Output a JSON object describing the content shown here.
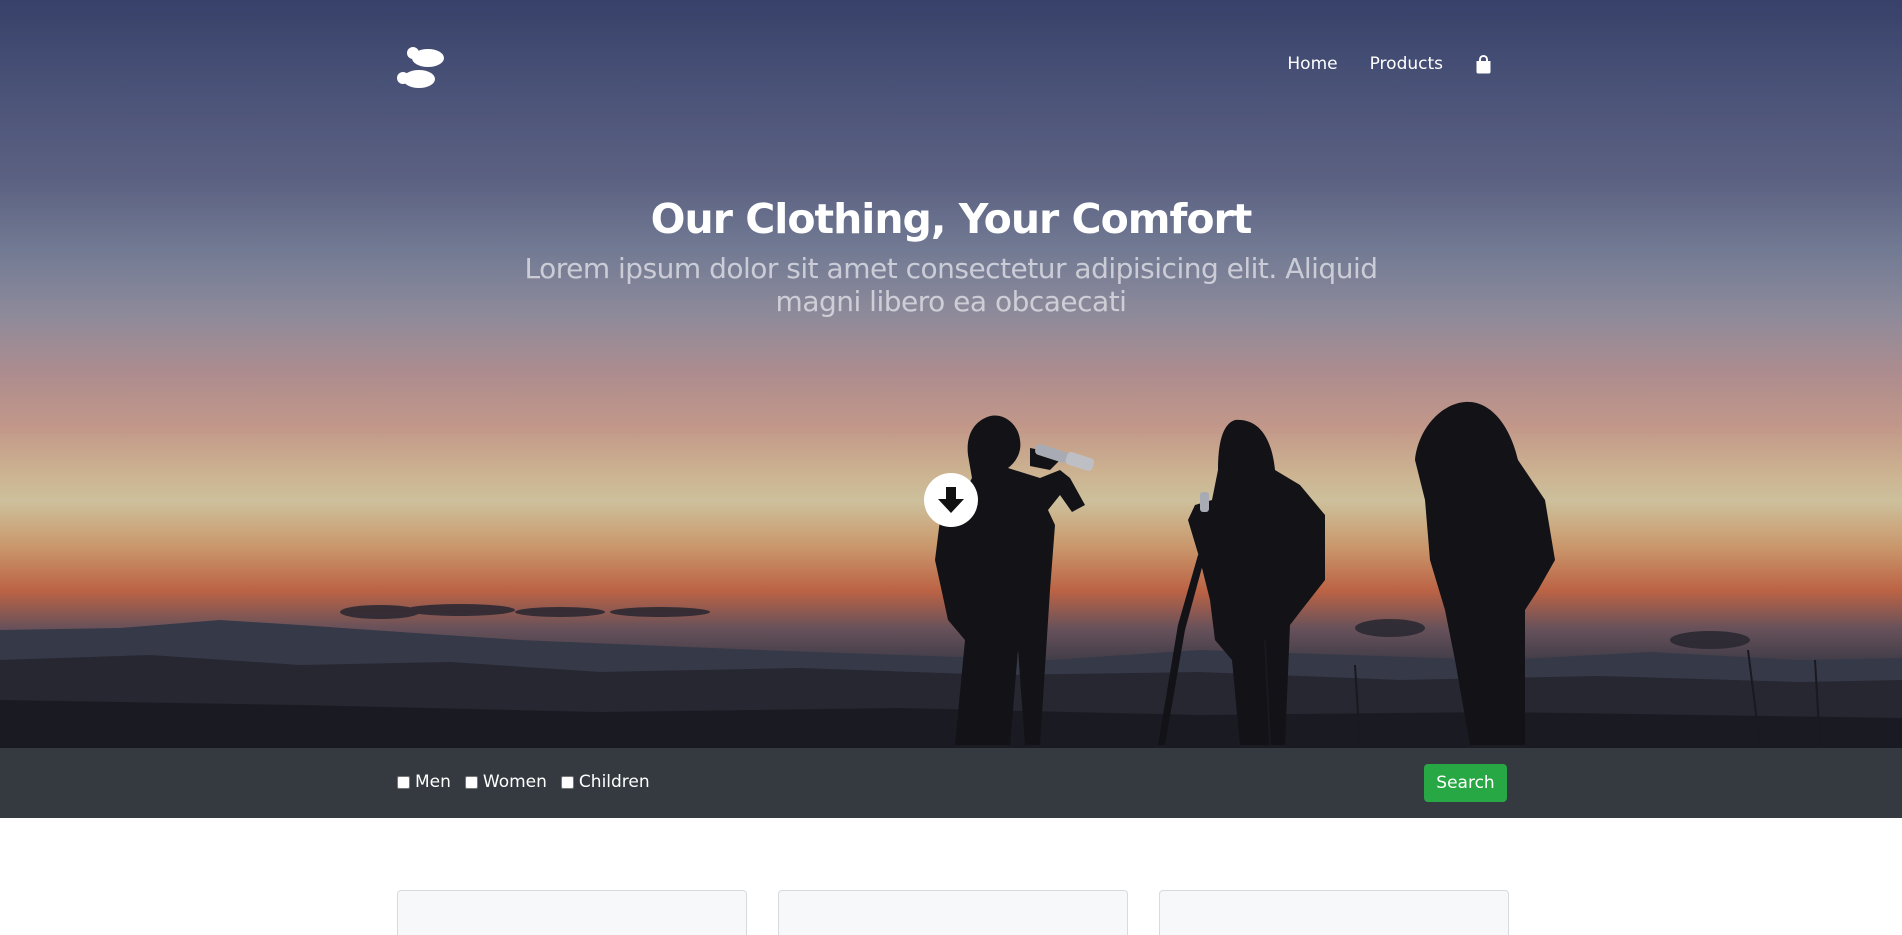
{
  "nav": {
    "logo_icon": "footprints-icon",
    "links": [
      {
        "label": "Home"
      },
      {
        "label": "Products"
      }
    ],
    "cart_icon": "shopping-bag-icon"
  },
  "hero": {
    "title": "Our Clothing, Your Comfort",
    "subtitle_line1": "Lorem ipsum dolor sit amet consectetur adipisicing elit. Aliquid",
    "subtitle_line2": "magni libero ea obcaecati",
    "scroll_icon": "arrow-down-icon",
    "background": "sunset-hikers-photo"
  },
  "filters": {
    "options": [
      {
        "label": "Men",
        "checked": false
      },
      {
        "label": "Women",
        "checked": false
      },
      {
        "label": "Children",
        "checked": false
      }
    ],
    "search_label": "Search"
  },
  "colors": {
    "filter_bar": "#343a40",
    "search_button": "#28a745",
    "card_background": "#f7f8f9"
  },
  "cards": [
    {},
    {},
    {}
  ]
}
